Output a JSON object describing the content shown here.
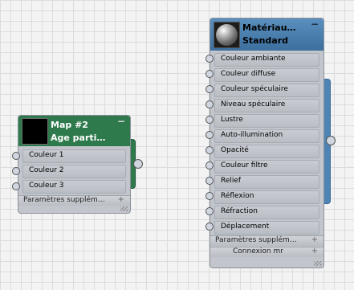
{
  "map_node": {
    "title": "Map #2",
    "subtitle": "Age parti…",
    "collapse": "−",
    "color": "#2f7a4c",
    "inputs": [
      "Couleur 1",
      "Couleur 2",
      "Couleur 3"
    ],
    "footer": "Paramètres supplém…",
    "footer_plus": "+"
  },
  "material_node": {
    "title": "Matériau…",
    "subtitle": "Standard",
    "collapse": "−",
    "color": "#4e84b4",
    "inputs": [
      "Couleur ambiante",
      "Couleur diffuse",
      "Couleur spéculaire",
      "Niveau spéculaire",
      "Lustre",
      "Auto-illumination",
      "Opacité",
      "Couleur filtre",
      "Relief",
      "Réflexion",
      "Réfraction",
      "Déplacement"
    ],
    "footer1": "Paramètres supplém…",
    "footer2": "Connexion mr",
    "footer_plus": "+"
  }
}
